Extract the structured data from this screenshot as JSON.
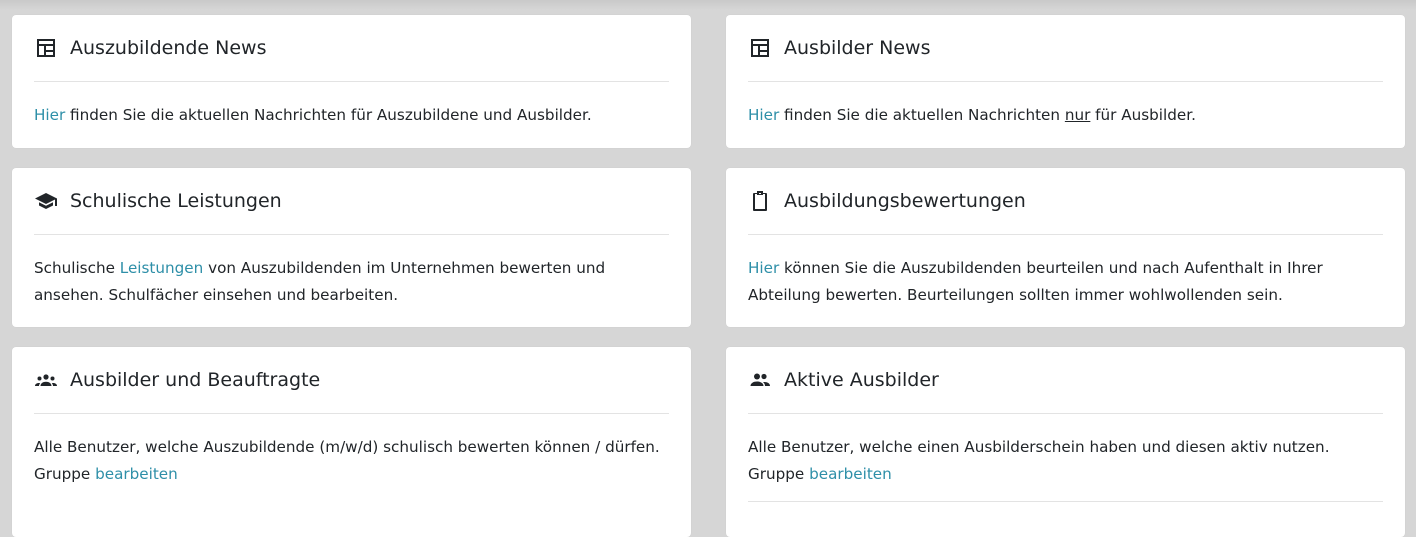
{
  "cards": [
    {
      "title": "Auszubildende News",
      "icon": "newspaper-icon",
      "body": {
        "link": "Hier",
        "text": " finden Sie die aktuellen Nachrichten für Auszubildene und Ausbilder."
      }
    },
    {
      "title": "Ausbilder News",
      "icon": "newspaper-icon",
      "body": {
        "link": "Hier",
        "pre": " finden Sie die aktuellen Nachrichten ",
        "underline": "nur",
        "post": " für Ausbilder."
      }
    },
    {
      "title": "Schulische Leistungen",
      "icon": "graduation-cap-icon",
      "body": {
        "pre": "Schulische ",
        "link": "Leistungen",
        "post": " von Auszubildenden im Unternehmen bewerten und ansehen. Schulfächer einsehen und bearbeiten."
      }
    },
    {
      "title": "Ausbildungsbewertungen",
      "icon": "clipboard-icon",
      "body": {
        "link": "Hier",
        "text": " können Sie die Auszubildenden beurteilen und nach Aufenthalt in Ihrer Abteilung bewerten. Beurteilungen sollten immer wohlwollenden sein."
      }
    },
    {
      "title": "Ausbilder und Beauftragte",
      "icon": "groups-icon",
      "body": {
        "text": "Alle Benutzer, welche Auszubildende (m/w/d) schulisch bewerten können / dürfen.",
        "group_label": "Gruppe ",
        "link": "bearbeiten"
      }
    },
    {
      "title": "Aktive Ausbilder",
      "icon": "people-icon",
      "body": {
        "text": "Alle Benutzer, welche einen Ausbilderschein haben und diesen aktiv nutzen.",
        "group_label": "Gruppe ",
        "link": "bearbeiten"
      }
    }
  ],
  "colors": {
    "link": "#2e8fa8",
    "background": "#d6d6d6",
    "card": "#ffffff"
  }
}
